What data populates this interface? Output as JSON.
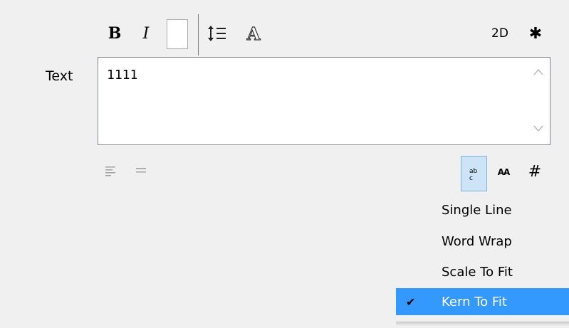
{
  "toolbar": {
    "bold_label": "B",
    "italic_label": "I",
    "font_label": "A",
    "twod_label": "2D",
    "settings_glyph": "✱",
    "icons": {
      "bold": "bold-icon",
      "italic": "italic-icon",
      "color": "color-swatch",
      "line_spacing": "line-spacing-icon",
      "font": "font-icon",
      "settings": "gear-icon"
    }
  },
  "text_field": {
    "label": "Text",
    "value": "1111"
  },
  "formatting_row": {
    "wrap_glyph": "ab\nc",
    "kerning_label": "AA",
    "grid_glyph": "#"
  },
  "wrap_menu": {
    "items": [
      {
        "label": "Single Line",
        "checked": false
      },
      {
        "label": "Word Wrap",
        "checked": false
      },
      {
        "label": "Scale To Fit",
        "checked": false
      },
      {
        "label": "Kern To Fit",
        "checked": true
      }
    ],
    "check_glyph": "✔"
  },
  "colors": {
    "background": "#f0f0f0",
    "selection": "#3399ff",
    "pressed_button": "#cde4f7"
  }
}
